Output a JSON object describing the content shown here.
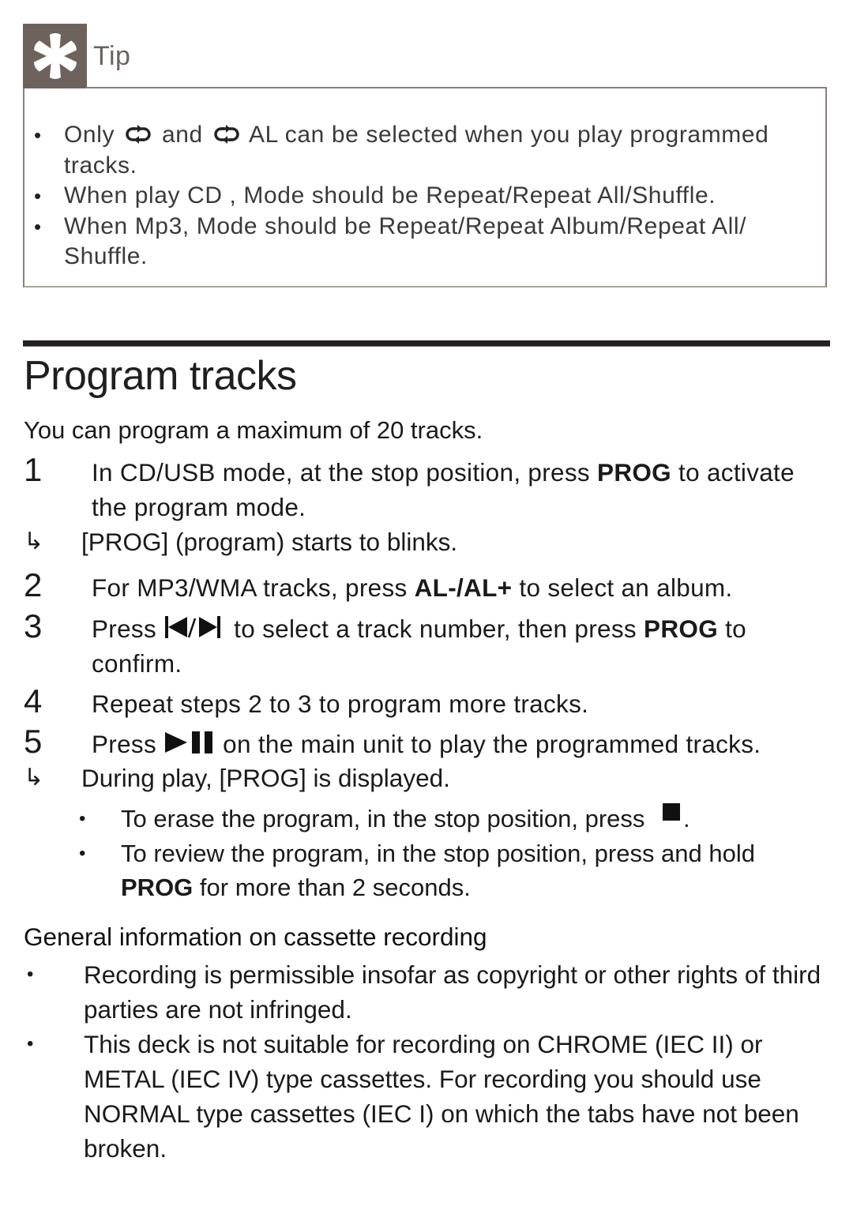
{
  "tip": {
    "icon": "asterisk-tip-icon",
    "title": "Tip",
    "items": [
      {
        "before": "Only",
        "icon1": "repeat-icon",
        "middle": "and",
        "icon2": "repeat-icon",
        "after": "AL can be selected when you play programmed tracks."
      },
      {
        "text": "When play CD , Mode should be Repeat/Repeat All/Shuffle."
      },
      {
        "text": "When Mp3, Mode should be Repeat/Repeat Album/Repeat All/ Shuffle."
      }
    ],
    "bullet": "•"
  },
  "section": {
    "title": "Program tracks",
    "intro": "You can program a maximum of 20 tracks.",
    "steps": [
      {
        "num": "1",
        "pre": "In CD/USB mode, at the stop position, press",
        "key": "PROG",
        "post": "to activate the program mode."
      },
      {
        "num": "2",
        "pre": "For MP3/WMA tracks, press",
        "key": "AL-/AL+",
        "post": "to select an album."
      },
      {
        "num": "3",
        "pre": "Press",
        "icon": "previous-next-icon",
        "mid": "to select a track number, then press",
        "key": "PROG",
        "post": "to confirm."
      },
      {
        "num": "4",
        "text": "Repeat steps 2 to 3 to program more tracks."
      },
      {
        "num": "5",
        "pre": "Press",
        "icon": "play-pause-icon",
        "post": "on the main unit to play the programmed tracks."
      }
    ],
    "results": [
      {
        "arrow": "↳",
        "text": "[PROG] (program) starts to blinks."
      },
      {
        "arrow": "↳",
        "text": "During play, [PROG] is displayed."
      }
    ],
    "notes": [
      {
        "bullet": "•",
        "pre": "To erase the program, in the stop position, press",
        "icon": "stop-icon",
        "post": "."
      },
      {
        "bullet": "•",
        "pre": "To review the program, in the stop position, press and hold",
        "key": "PROG",
        "post": "for more than 2 seconds."
      }
    ]
  },
  "general_info": {
    "heading": "General information on cassette recording",
    "items": [
      {
        "bullet": "•",
        "text": "Recording is permissible insofar as copyright or other rights of third parties are not infringed."
      },
      {
        "bullet": "•",
        "text": "This deck is not suitable for recording on CHROME (IEC II) or METAL (IEC IV) type cassettes. For recording you should use NORMAL type cassettes (IEC I) on which the tabs have not been broken."
      }
    ]
  },
  "colors": {
    "tip_accent": "#6e625f",
    "text": "#1a1a1a"
  }
}
